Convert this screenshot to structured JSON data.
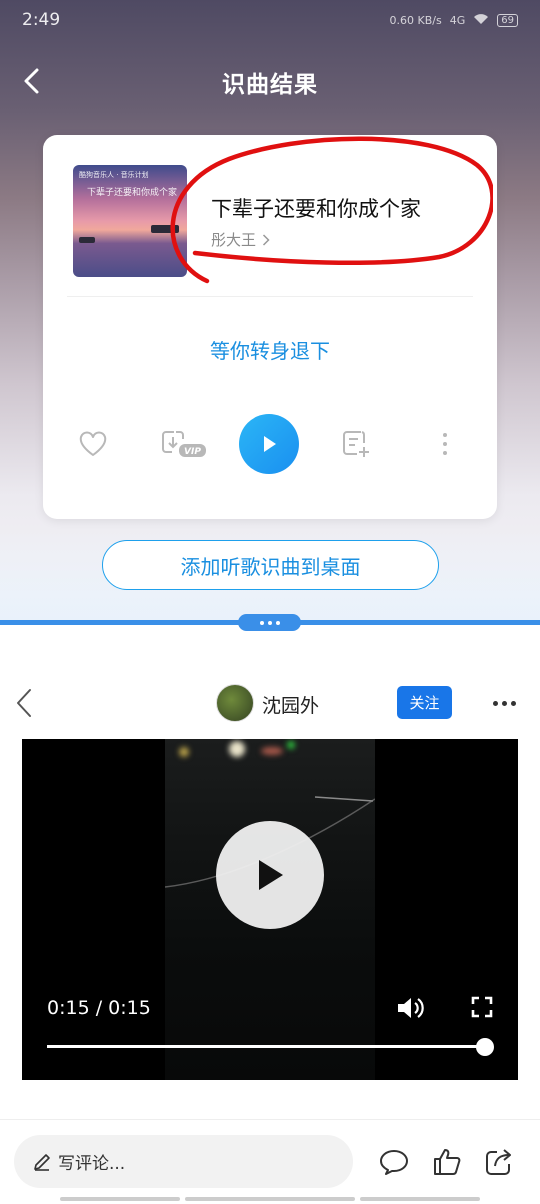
{
  "status": {
    "time": "2:49",
    "net_speed": "0.60 KB/s",
    "signal": "4G",
    "battery": "69"
  },
  "nav": {
    "title": "识曲结果"
  },
  "song": {
    "title": "下辈子还要和你成个家",
    "artist": "彤大王",
    "lyric": "等你转身退下"
  },
  "cover": {
    "tiny_text": "酷狗音乐人 · 音乐计划",
    "script_text": "下辈子还要和你成个家"
  },
  "actions": {
    "icons": [
      "heart-icon",
      "download-vip-icon",
      "play-icon",
      "add-to-playlist-icon",
      "more-vertical-icon"
    ],
    "vip_label": "VIP"
  },
  "add_desktop_label": "添加听歌识曲到桌面",
  "video_header": {
    "username": "沈园外",
    "follow_label": "关注"
  },
  "video": {
    "time": "0:15 / 0:15",
    "progress": 1.0
  },
  "comment": {
    "placeholder": "写评论..."
  },
  "colors": {
    "accent": "#1a8fe0",
    "follow": "#1976e8",
    "annotation": "#e01010"
  }
}
